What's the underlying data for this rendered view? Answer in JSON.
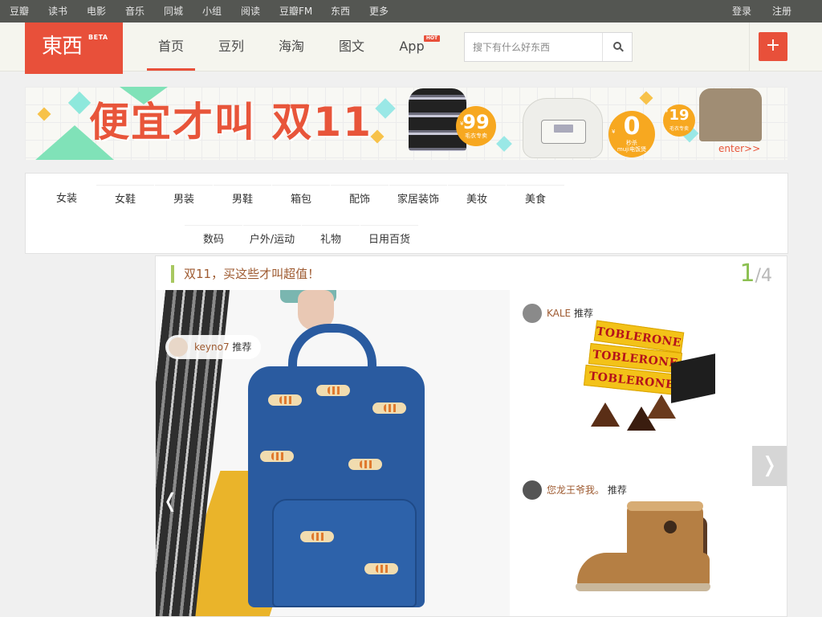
{
  "topbar": {
    "links": [
      "豆瓣",
      "读书",
      "电影",
      "音乐",
      "同城",
      "小组",
      "阅读",
      "豆瓣FM",
      "东西",
      "更多"
    ],
    "login": "登录",
    "register": "注册"
  },
  "header": {
    "logo_text": "東西",
    "logo_badge": "BETA",
    "nav": [
      "首页",
      "豆列",
      "海淘",
      "图文",
      "App"
    ],
    "hot_badge": "HOT",
    "search_placeholder": "搜下有什么好东西",
    "add_label": "+"
  },
  "banner": {
    "headline": "便宜才叫 双11",
    "price1": "99",
    "price1_sub": "毛衣专卖",
    "price2": "0",
    "price2_sub_line1": "秒杀",
    "price2_sub_line2": "muji电饭煲",
    "price3": "19",
    "price3_sub": "毛衣专卖",
    "currency": "¥",
    "enter": "enter>>"
  },
  "categories": {
    "row1": [
      "女装",
      "女鞋",
      "男装",
      "男鞋",
      "箱包",
      "配饰",
      "家居装饰",
      "美妆",
      "美食"
    ],
    "row2": [
      "数码",
      "户外/运动",
      "礼物",
      "日用百货"
    ]
  },
  "feature": {
    "title": "双11，买这些才叫超值！",
    "page_current": "1",
    "page_sep": "/",
    "page_total": "4",
    "main_user": "keyno7",
    "recommend": "推荐",
    "card1_user": "KALE",
    "card1_product": "TOBLERONE",
    "card2_user": "您龙王爷我。",
    "prev": "❬",
    "next": "❭"
  },
  "colors": {
    "brand_red": "#e8503a",
    "topbar": "#545652",
    "accent_green": "#8cc051",
    "username_brown": "#9e5a30"
  }
}
